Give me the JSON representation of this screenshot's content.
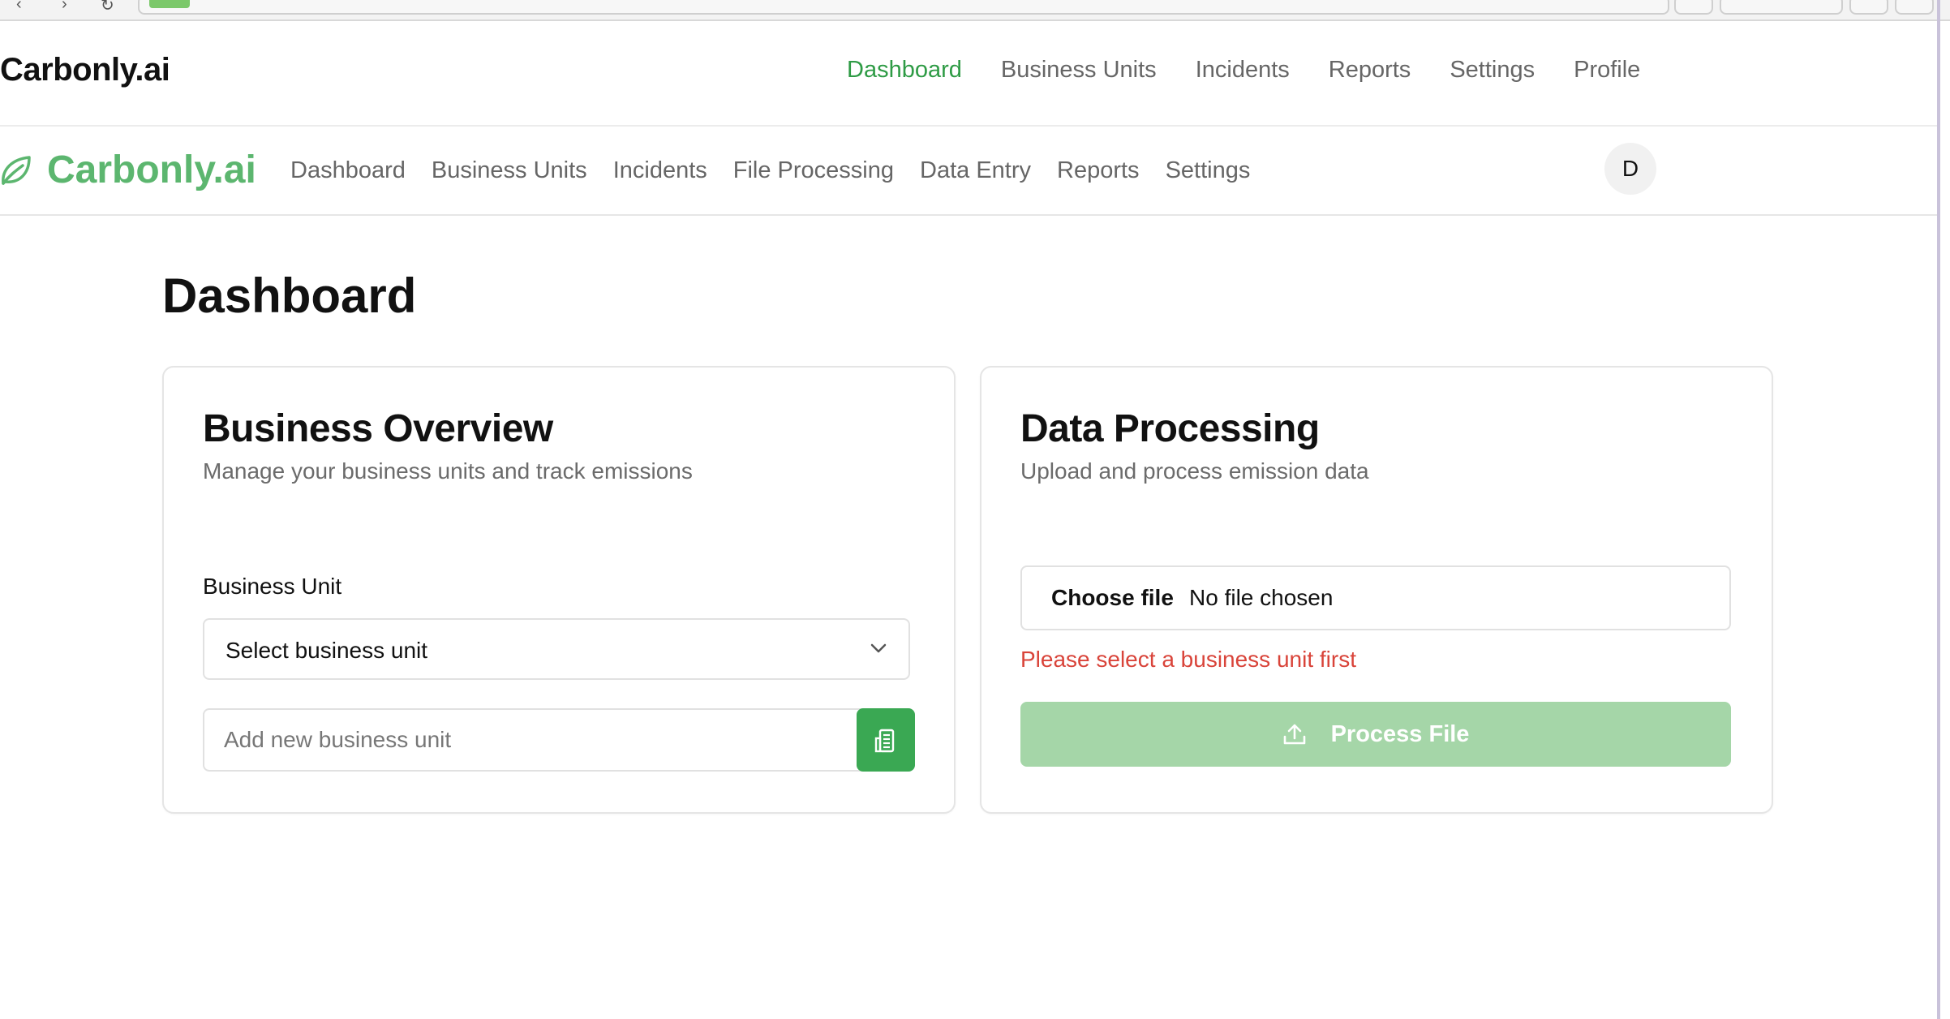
{
  "outer_header": {
    "logo": "Carbonly.ai",
    "nav": [
      "Dashboard",
      "Business Units",
      "Incidents",
      "Reports",
      "Settings",
      "Profile"
    ],
    "active": "Dashboard"
  },
  "app_header": {
    "logo": "Carbonly.ai",
    "nav": [
      "Dashboard",
      "Business Units",
      "Incidents",
      "File Processing",
      "Data Entry",
      "Reports",
      "Settings"
    ],
    "avatar_initial": "D"
  },
  "page": {
    "title": "Dashboard"
  },
  "business_overview": {
    "title": "Business Overview",
    "subtitle": "Manage your business units and track emissions",
    "field_label": "Business Unit",
    "select_value": "Select business unit",
    "new_unit_placeholder": "Add new business unit"
  },
  "data_processing": {
    "title": "Data Processing",
    "subtitle": "Upload and process emission data",
    "choose_file": "Choose file",
    "file_status": "No file chosen",
    "error": "Please select a business unit first",
    "process_label": "Process File"
  },
  "colors": {
    "accent": "#2e9b45",
    "logo_green": "#5cb66f",
    "button_green": "#3aa853",
    "disabled_green": "#a5d6a8",
    "error": "#d9443a"
  }
}
